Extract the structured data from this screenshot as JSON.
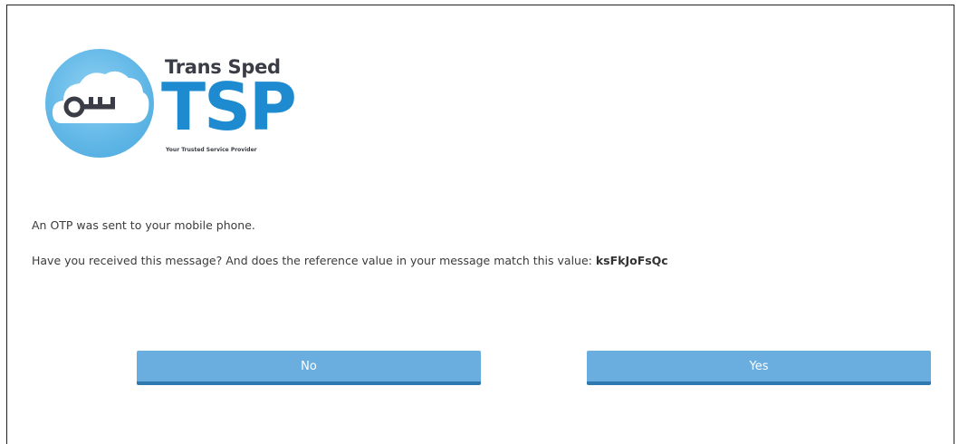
{
  "logo": {
    "brand_name": "Trans Sped",
    "abbreviation": "TSP",
    "tagline": "Your Trusted Service Provider",
    "icon": "cloud-key-icon",
    "colors": {
      "circle": "#5fb6e6",
      "abbreviation": "#1e8bd1",
      "brand_name": "#3a3d45"
    }
  },
  "message": {
    "line1": "An OTP was sent to your mobile phone.",
    "line2": "Have you received this message? And does the reference value in your message match this value:",
    "reference_value": "ksFkJoFsQc"
  },
  "buttons": {
    "no_label": "No",
    "yes_label": "Yes",
    "color": "#6aaee0",
    "border_color": "#2e79b0"
  }
}
